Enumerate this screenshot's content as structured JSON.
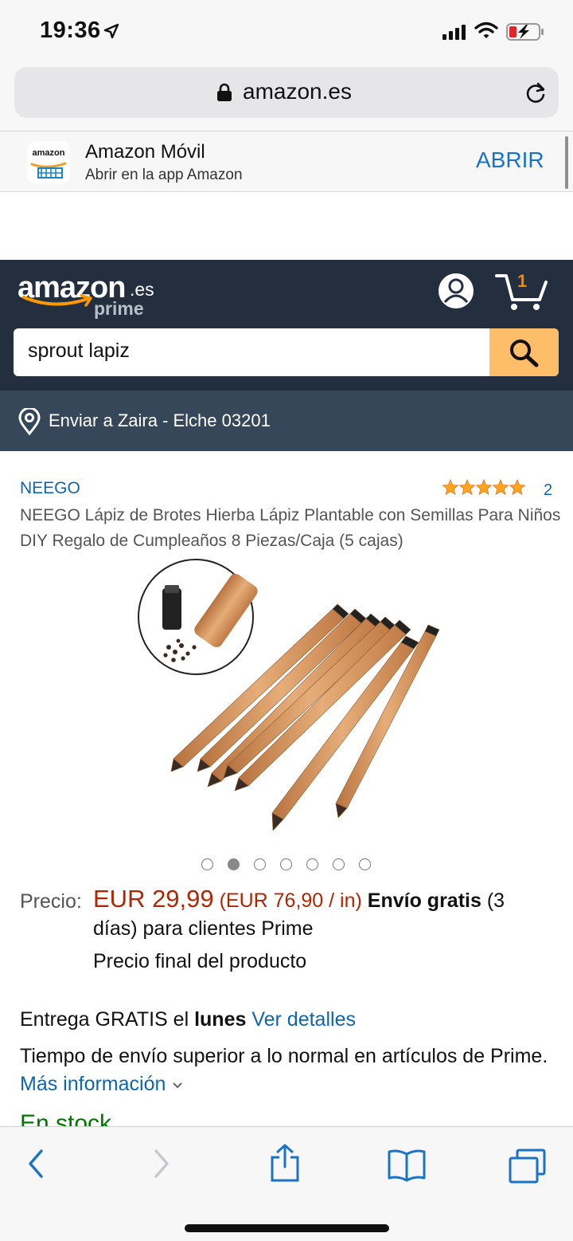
{
  "status_bar": {
    "time": "19:36"
  },
  "browser": {
    "url": "amazon.es"
  },
  "app_banner": {
    "icon_text": "amazon",
    "title": "Amazon Móvil",
    "subtitle": "Abrir en la app Amazon",
    "open_label": "ABRIR"
  },
  "header": {
    "logo_main": "amazon",
    "logo_tld": ".es",
    "logo_sub": "prime",
    "cart_count": "1",
    "search_query": "sprout lapiz"
  },
  "deliver_to": "Enviar a Zaira - Elche 03201",
  "product": {
    "brand": "NEEGO",
    "rating_count": "2",
    "rating": 5,
    "title": "NEEGO Lápiz de Brotes Hierba Lápiz Plantable con Semillas Para Niños DIY Regalo de Cumpleaños 8 Piezas/Caja (5 cajas)",
    "image_count": 7,
    "active_image_index": 1
  },
  "pricing": {
    "label": "Precio:",
    "price": "EUR 29,99",
    "unit_price": "(EUR 76,90 / in)",
    "free_shipping": "Envío gratis",
    "shipping_detail": " (3 días) para clientes Prime",
    "final_note": "Precio final del producto"
  },
  "delivery": {
    "prefix": "Entrega GRATIS el ",
    "day": "lunes",
    "details_link": "Ver detalles",
    "notice": "Tiempo de envío superior a lo normal en artículos de Prime. ",
    "more_link": "Más información",
    "stock": "En stock"
  },
  "colors": {
    "header_bg": "#232f3e",
    "deliver_bg": "#37475a",
    "search_button": "#febd69",
    "price": "#b12704",
    "link": "#0f66b0",
    "stock": "#007600",
    "ios_blue": "#1a73c8"
  },
  "toolbar": {
    "icons": [
      "back-icon",
      "forward-icon",
      "share-icon",
      "bookmarks-icon",
      "tabs-icon"
    ]
  }
}
